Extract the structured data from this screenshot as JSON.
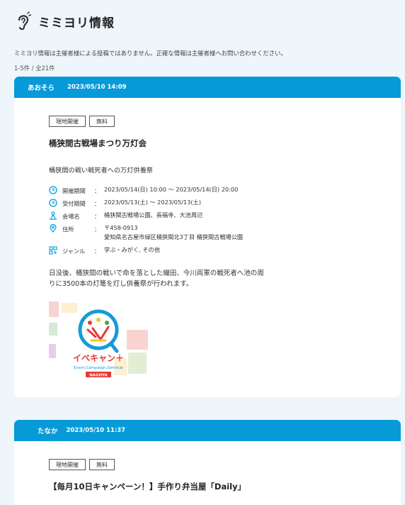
{
  "header": {
    "title": "ミミヨリ情報",
    "icon": "ear-icon"
  },
  "notice": "ミミヨリ情報は主催者様による投稿ではありません。正確な情報は主催者様へお問い合わせください。",
  "count": "1-5件 / 全21件",
  "colors": {
    "accent": "#079ad9",
    "background": "#eef5fb"
  },
  "posts": [
    {
      "author": "あおそら",
      "posted_at": "2023/05/10 14:09",
      "tags": [
        "現地開催",
        "無料"
      ],
      "title": "桶狭間古戦場まつり万灯会",
      "subtitle": "桶狭間の戦い戦死者への万灯供養祭",
      "details": {
        "period": {
          "label": "開催期間",
          "value": "2023/05/14(日) 10:00 〜 2023/05/14(日) 20:00"
        },
        "reception": {
          "label": "受付期間",
          "value": "2023/05/13(土) 〜 2023/05/13(土)"
        },
        "venue": {
          "label": "会場名",
          "value": "桶狭間古戦場公園、長福寺、大池周辺"
        },
        "address": {
          "label": "住所",
          "zip": "〒458-0913",
          "value": "愛知県名古屋市緑区桶狭間北3丁目 桶狭間古戦場公園"
        },
        "genre": {
          "label": "ジャンル",
          "value": "学ぶ・みがく, その他"
        }
      },
      "colon": "：",
      "description": "日没後、桶狭間の戦いで命を落とした織田、今川両軍の戦死者へ池の周りに3500本の灯篭を灯し供養祭が行われます。",
      "image": {
        "logo_text": "イベキャン＋",
        "logo_sub": "Event,Campaign,Seminar",
        "logo_badge": "NAGOYA"
      }
    },
    {
      "author": "たなか",
      "posted_at": "2023/05/10 11:37",
      "tags": [
        "現地開催",
        "無料"
      ],
      "title": "【毎月10日キャンペーン！】手作り弁当屋「Daily」"
    }
  ]
}
